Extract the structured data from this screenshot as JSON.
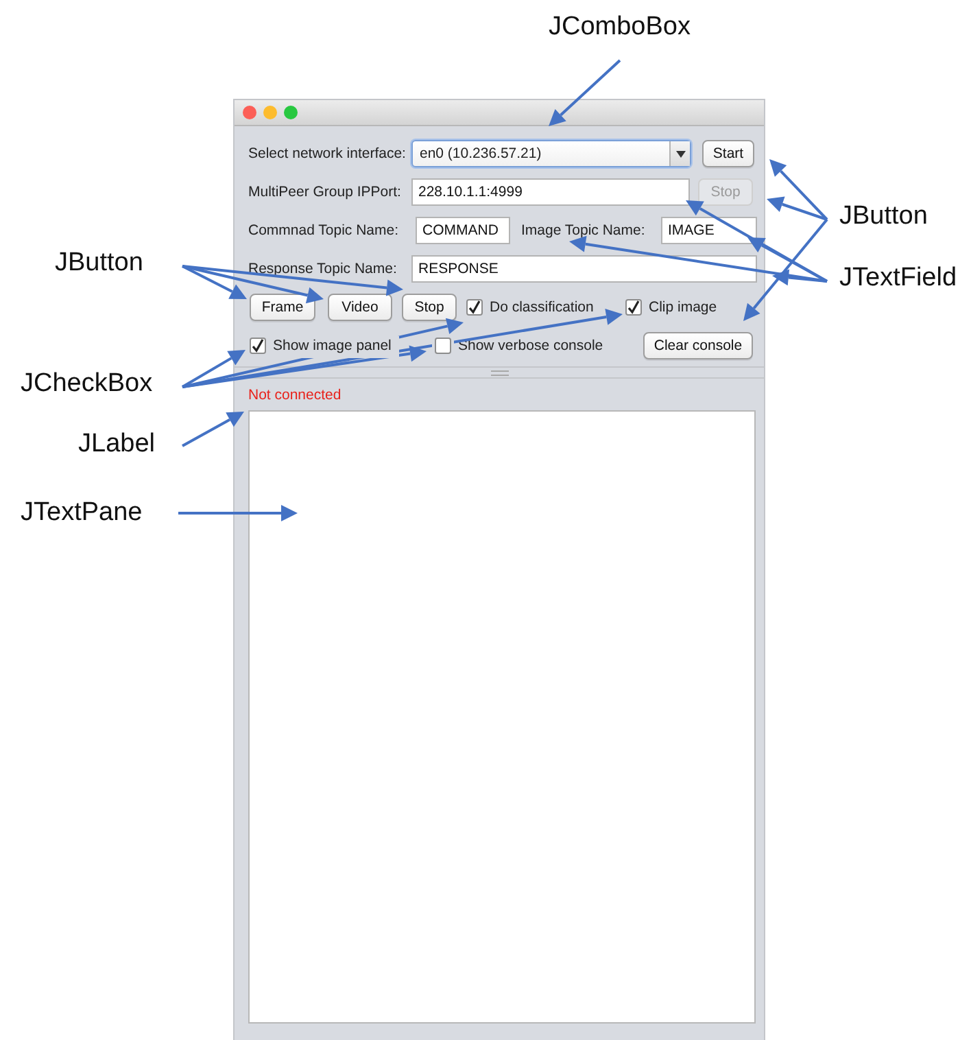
{
  "annotations": [
    {
      "text": "JComboBox"
    },
    {
      "text": "JButton"
    },
    {
      "text": "JCheckBox"
    },
    {
      "text": "JLabel"
    },
    {
      "text": "JTextPane"
    },
    {
      "text": "JButton"
    },
    {
      "text": "JTextField"
    }
  ],
  "window": {
    "network_interface": {
      "label": "Select network interface:",
      "value": "en0 (10.236.57.21)"
    },
    "start_button": {
      "label": "Start",
      "disabled": false
    },
    "group_ipport": {
      "label": "MultiPeer Group IPPort:",
      "value": "228.10.1.1:4999"
    },
    "stop_button": {
      "label": "Stop",
      "disabled": true
    },
    "command_topic": {
      "label": "Commnad Topic Name:",
      "value": "COMMAND"
    },
    "image_topic": {
      "label": "Image Topic Name:",
      "value": "IMAGE"
    },
    "response_topic": {
      "label": "Response Topic Name:",
      "value": "RESPONSE"
    },
    "action_buttons": [
      {
        "label": "Frame",
        "disabled": false
      },
      {
        "label": "Video",
        "disabled": false
      },
      {
        "label": "Stop",
        "disabled": false
      }
    ],
    "options": [
      {
        "label": "Do classification",
        "checked": true
      },
      {
        "label": "Clip image",
        "checked": true
      },
      {
        "label": "Show image panel",
        "checked": true
      },
      {
        "label": "Show verbose console",
        "checked": false
      }
    ],
    "clear_button": {
      "label": "Clear console",
      "disabled": false
    },
    "status": "Not connected"
  }
}
